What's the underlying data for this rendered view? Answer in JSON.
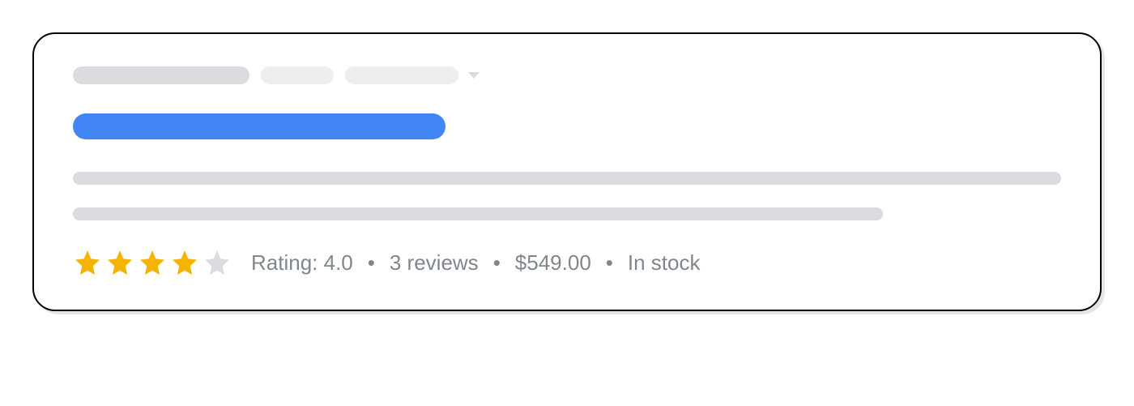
{
  "rating": {
    "stars_filled": 4,
    "stars_total": 5,
    "label": "Rating: 4.0",
    "reviews": "3 reviews",
    "price": "$549.00",
    "stock": "In stock"
  }
}
